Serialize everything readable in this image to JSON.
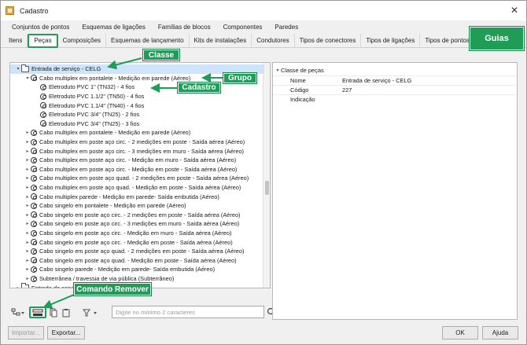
{
  "window": {
    "title": "Cadastro",
    "close_glyph": "✕"
  },
  "tabs_row1": [
    "Conjuntos de pontos",
    "Esquemas de ligações",
    "Famílias de blocos",
    "Componentes",
    "Paredes"
  ],
  "tabs_row2": [
    "Itens",
    "Peças",
    "Composições",
    "Esquemas de lançamento",
    "Kits de instalações",
    "Condutores",
    "Tipos de conectores",
    "Tipos de ligações",
    "Tipos de pontos"
  ],
  "active_tab_index": 1,
  "tree": [
    {
      "level": 0,
      "expander": "▾",
      "icon": "folder-icon",
      "label": "Entrada de serviço - CELG",
      "selected": true
    },
    {
      "level": 1,
      "expander": "▾",
      "icon": "piece-icon",
      "label": "Cabo multiplex em pontalete - Medição em parede (Aéreo)"
    },
    {
      "level": 2,
      "expander": "",
      "icon": "piece-icon",
      "label": "Eletroduto PVC 1\" (TN32) - 4 fios"
    },
    {
      "level": 2,
      "expander": "",
      "icon": "piece-icon",
      "label": "Eletroduto PVC 1.1/2\" (TN50) - 4 fios"
    },
    {
      "level": 2,
      "expander": "",
      "icon": "piece-icon",
      "label": "Eletroduto PVC 1.1/4\" (TN40) - 4 fios"
    },
    {
      "level": 2,
      "expander": "",
      "icon": "piece-icon",
      "label": "Eletroduto PVC 3/4\" (TN25) - 2 fios"
    },
    {
      "level": 2,
      "expander": "",
      "icon": "piece-icon",
      "label": "Eletroduto PVC 3/4\" (TN25) - 3 fios"
    },
    {
      "level": 1,
      "expander": "▸",
      "icon": "piece-icon",
      "label": "Cabo multiplex em pontalete - Medição em parede (Aéreo)"
    },
    {
      "level": 1,
      "expander": "▸",
      "icon": "piece-icon",
      "label": "Cabo multiplex em poste aço circ. - 2 medições em poste - Saída aérea (Aéreo)"
    },
    {
      "level": 1,
      "expander": "▸",
      "icon": "piece-icon",
      "label": "Cabo multiplex em poste aço circ. - 3 medições em muro - Saída aérea (Aéreo)"
    },
    {
      "level": 1,
      "expander": "▸",
      "icon": "piece-icon",
      "label": "Cabo multiplex em poste aço circ. - Medição em muro - Saída aérea (Aéreo)"
    },
    {
      "level": 1,
      "expander": "▸",
      "icon": "piece-icon",
      "label": "Cabo multiplex em poste aço circ. - Medição em poste - Saída aérea (Aéreo)"
    },
    {
      "level": 1,
      "expander": "▸",
      "icon": "piece-icon",
      "label": "Cabo multiplex em poste aço quad. - 2 medições em poste - Saída aérea (Aéreo)"
    },
    {
      "level": 1,
      "expander": "▸",
      "icon": "piece-icon",
      "label": "Cabo multiplex em poste aço quad. - Medição em poste - Saída aérea (Aéreo)"
    },
    {
      "level": 1,
      "expander": "▸",
      "icon": "piece-icon",
      "label": "Cabo multiplex parede - Medição em parede- Saída embutida (Aéreo)"
    },
    {
      "level": 1,
      "expander": "▸",
      "icon": "piece-icon",
      "label": "Cabo singelo em pontalete - Medição em parede (Aéreo)"
    },
    {
      "level": 1,
      "expander": "▸",
      "icon": "piece-icon",
      "label": "Cabo singelo em poste aço circ. - 2 medições em poste - Saída aérea (Aéreo)"
    },
    {
      "level": 1,
      "expander": "▸",
      "icon": "piece-icon",
      "label": "Cabo singelo em poste aço circ. - 3 medições em muro - Saída aérea (Aéreo)"
    },
    {
      "level": 1,
      "expander": "▸",
      "icon": "piece-icon",
      "label": "Cabo singelo em poste aço circ. - Medição em muro - Saída aérea (Aéreo)"
    },
    {
      "level": 1,
      "expander": "▸",
      "icon": "piece-icon",
      "label": "Cabo singelo em poste aço circ. - Medição em poste - Saída aérea (Aéreo)"
    },
    {
      "level": 1,
      "expander": "▸",
      "icon": "piece-icon",
      "label": "Cabo singelo em poste aço quad. - 2 medições em poste - Saída aérea (Aéreo)"
    },
    {
      "level": 1,
      "expander": "▸",
      "icon": "piece-icon",
      "label": "Cabo singelo em poste aço quad. - Medição em poste - Saída aérea (Aéreo)"
    },
    {
      "level": 1,
      "expander": "▸",
      "icon": "piece-icon",
      "label": "Cabo singelo parede - Medição em parede- Saída embutida (Aéreo)"
    },
    {
      "level": 1,
      "expander": "▸",
      "icon": "piece-icon",
      "label": "Subterrânea / travessia de via pública (Subterrâneo)"
    },
    {
      "level": 0,
      "expander": "▸",
      "icon": "folder-icon",
      "label": "Entrada de serviço"
    },
    {
      "level": 0,
      "expander": "▸",
      "icon": "folder-icon",
      "label": "Entrada de serviço"
    }
  ],
  "toolbar": {
    "search_placeholder": "Digite no mínimo 2 caracteres"
  },
  "properties": {
    "category": "Classe de peças",
    "rows": [
      {
        "name": "Nome",
        "value": "Entrada de serviço - CELG"
      },
      {
        "name": "Código",
        "value": "227"
      },
      {
        "name": "Indicação",
        "value": ""
      }
    ]
  },
  "footer": {
    "import_label": "Importar...",
    "export_label": "Exportar...",
    "ok_label": "OK",
    "help_label": "Ajuda"
  },
  "callouts": {
    "guias": "Guias",
    "classe": "Classe",
    "grupo": "Grupo",
    "cadastro": "Cadastro",
    "comando_remover": "Comando Remover"
  },
  "colors": {
    "callout": "#1f9d57",
    "selection": "#cde4fa"
  }
}
